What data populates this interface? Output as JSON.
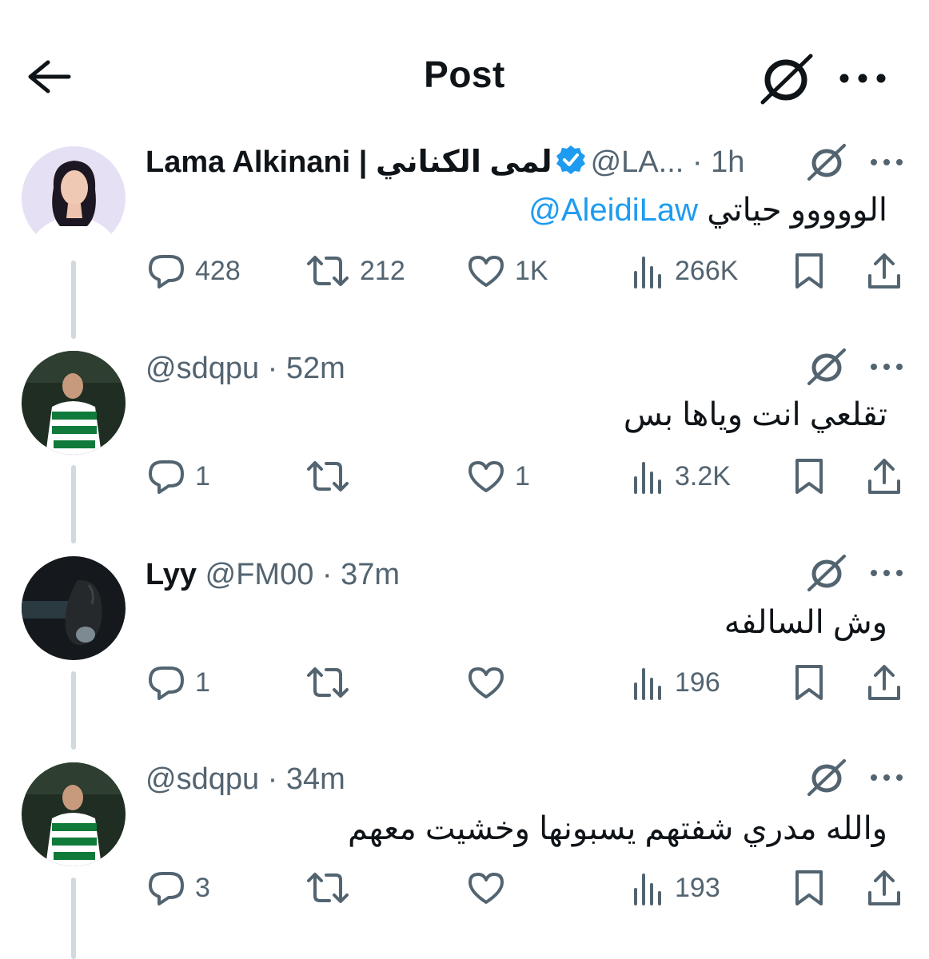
{
  "header": {
    "title": "Post"
  },
  "tweets": [
    {
      "name": "Lama Alkinani | لمى الكناني",
      "verified": true,
      "handle": "@LA...",
      "time": "1h",
      "text": "الووووو حياتي",
      "mention": "@AleidiLaw",
      "replies": "428",
      "reposts": "212",
      "likes": "1K",
      "views": "266K"
    },
    {
      "name": "",
      "handle": "@sdqpu",
      "time": "52m",
      "text": "تقلعي انت وياها بس",
      "replies": "1",
      "reposts": "",
      "likes": "1",
      "views": "3.2K"
    },
    {
      "name": "Lyy",
      "handle": "@FM00",
      "time": "37m",
      "text": "وش السالفه",
      "replies": "1",
      "reposts": "",
      "likes": "",
      "views": "196"
    },
    {
      "name": "",
      "handle": "@sdqpu",
      "time": "34m",
      "text": "والله مدري شفتهم يسبونها وخشيت معهم",
      "replies": "3",
      "reposts": "",
      "likes": "",
      "views": "193"
    }
  ],
  "colors": {
    "accent": "#1d9bf0",
    "text": "#0f1419",
    "secondary": "#536471",
    "thread": "#cfd9de"
  },
  "icons": [
    "back-arrow-icon",
    "grok-icon",
    "more-icon",
    "verified-badge-icon",
    "reply-icon",
    "repost-icon",
    "like-icon",
    "views-icon",
    "bookmark-icon",
    "share-icon"
  ]
}
